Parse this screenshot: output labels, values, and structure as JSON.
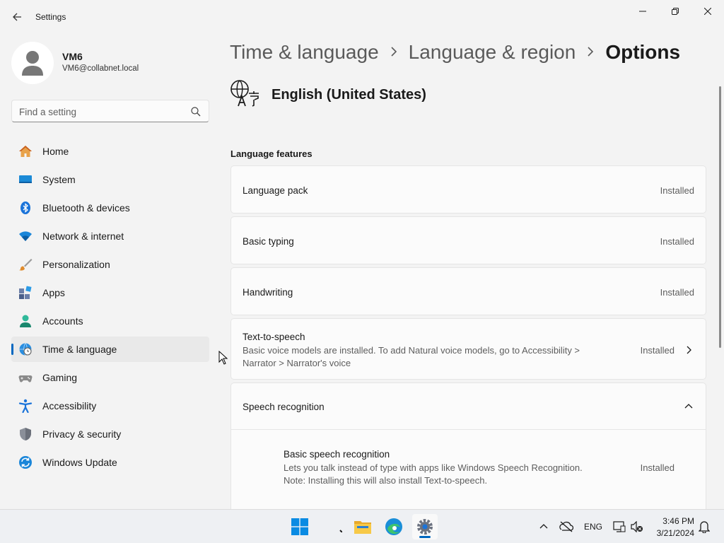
{
  "window": {
    "app_title": "Settings"
  },
  "profile": {
    "name": "VM6",
    "email": "VM6@collabnet.local"
  },
  "search": {
    "placeholder": "Find a setting"
  },
  "nav": {
    "items": [
      {
        "label": "Home",
        "icon": "home-icon"
      },
      {
        "label": "System",
        "icon": "system-icon"
      },
      {
        "label": "Bluetooth & devices",
        "icon": "bluetooth-icon"
      },
      {
        "label": "Network & internet",
        "icon": "wifi-icon"
      },
      {
        "label": "Personalization",
        "icon": "brush-icon"
      },
      {
        "label": "Apps",
        "icon": "apps-icon"
      },
      {
        "label": "Accounts",
        "icon": "accounts-icon"
      },
      {
        "label": "Time & language",
        "icon": "globe-clock-icon",
        "selected": true
      },
      {
        "label": "Gaming",
        "icon": "gamepad-icon"
      },
      {
        "label": "Accessibility",
        "icon": "accessibility-icon"
      },
      {
        "label": "Privacy & security",
        "icon": "shield-icon"
      },
      {
        "label": "Windows Update",
        "icon": "update-icon"
      }
    ]
  },
  "breadcrumb": {
    "items": [
      "Time & language",
      "Language & region",
      "Options"
    ]
  },
  "language": {
    "name": "English (United States)",
    "icon": "language-icon"
  },
  "features": {
    "section_title": "Language features",
    "language_pack": {
      "label": "Language pack",
      "status": "Installed"
    },
    "basic_typing": {
      "label": "Basic typing",
      "status": "Installed"
    },
    "handwriting": {
      "label": "Handwriting",
      "status": "Installed"
    },
    "tts": {
      "label": "Text-to-speech",
      "desc_line1": "Basic voice models are installed. To add Natural voice models, go to Accessibility >",
      "desc_line2": "Narrator > Narrator's voice",
      "status": "Installed"
    },
    "speech_recognition": {
      "label": "Speech recognition",
      "expanded": true,
      "basic": {
        "label": "Basic speech recognition",
        "desc_line1": "Lets you talk instead of type with apps like Windows Speech Recognition.",
        "desc_line2": "Note: Installing this will also install Text-to-speech.",
        "status": "Installed"
      }
    }
  },
  "taskbar": {
    "apps": [
      "start-icon",
      "search-taskbar-icon",
      "file-explorer-icon",
      "edge-icon",
      "settings-icon"
    ],
    "tray_lang": "ENG",
    "time": "3:46 PM",
    "date": "3/21/2024"
  },
  "colors": {
    "accent": "#0067c0",
    "background": "#f3f3f3",
    "card": "#fbfbfb"
  }
}
